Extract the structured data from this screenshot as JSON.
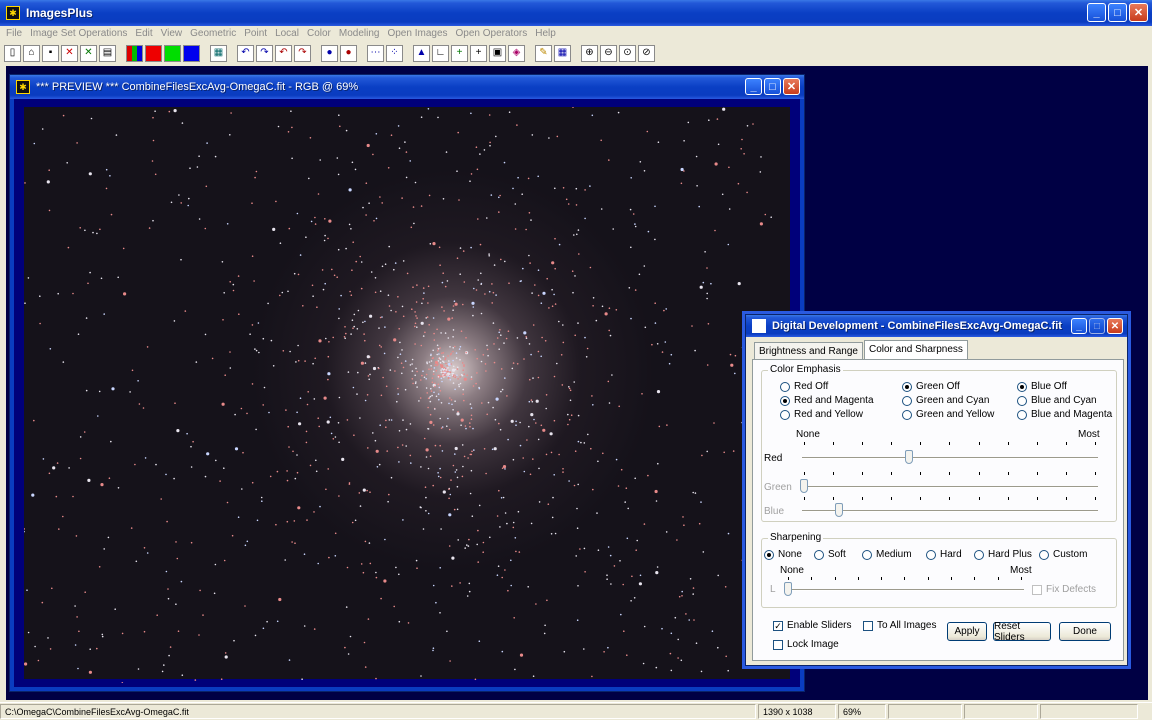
{
  "app": {
    "title": "ImagesPlus",
    "menu": [
      "File",
      "Image Set Operations",
      "Edit",
      "View",
      "Geometric",
      "Point",
      "Local",
      "Color",
      "Modeling",
      "Open Images",
      "Open Operators",
      "Help"
    ],
    "window_buttons": {
      "minimize": "_",
      "maximize": "□",
      "close": "✕"
    }
  },
  "toolbar": {
    "icons": [
      "new-icon",
      "open-icon",
      "save-icon",
      "close-red-icon",
      "close-green-icon",
      "print-icon",
      "rgb-channels-icon",
      "red-channel-icon",
      "green-channel-icon",
      "blue-channel-icon",
      "grid-icon",
      "undo-icon",
      "redo-icon",
      "undo-all-icon",
      "redo-all-icon",
      "circle-select-icon",
      "circle-red-icon",
      "dots-icon",
      "scatter-icon",
      "histogram-icon",
      "crop-icon",
      "crosshair-icon",
      "cross-icon",
      "calc-icon",
      "palette-icon",
      "pencil-icon",
      "table-icon",
      "zoom-in-icon",
      "zoom-out-icon",
      "zoom-fit-icon",
      "zoom-actual-icon"
    ]
  },
  "preview": {
    "title": "*** PREVIEW *** CombineFilesExcAvg-OmegaC.fit - RGB @ 69%"
  },
  "dialog": {
    "title": "Digital Development - CombineFilesExcAvg-OmegaC.fit",
    "tabs": [
      {
        "label": "Brightness and Range",
        "active": false
      },
      {
        "label": "Color and Sharpness",
        "active": true
      }
    ],
    "color_emphasis": {
      "label": "Color Emphasis",
      "red_options": [
        {
          "label": "Red Off",
          "selected": false
        },
        {
          "label": "Red and Magenta",
          "selected": true
        },
        {
          "label": "Red and Yellow",
          "selected": false
        }
      ],
      "green_options": [
        {
          "label": "Green Off",
          "selected": true
        },
        {
          "label": "Green and Cyan",
          "selected": false
        },
        {
          "label": "Green and Yellow",
          "selected": false
        }
      ],
      "blue_options": [
        {
          "label": "Blue Off",
          "selected": true
        },
        {
          "label": "Blue and Cyan",
          "selected": false
        },
        {
          "label": "Blue and Magenta",
          "selected": false
        }
      ],
      "scale_min": "None",
      "scale_max": "Most",
      "sliders": [
        {
          "label": "Red",
          "value": 0.36,
          "enabled": true
        },
        {
          "label": "Green",
          "value": 0.0,
          "enabled": false
        },
        {
          "label": "Blue",
          "value": 0.12,
          "enabled": false
        }
      ]
    },
    "sharpening": {
      "label": "Sharpening",
      "options": [
        {
          "label": "None",
          "selected": true
        },
        {
          "label": "Soft",
          "selected": false
        },
        {
          "label": "Medium",
          "selected": false
        },
        {
          "label": "Hard",
          "selected": false
        },
        {
          "label": "Hard Plus",
          "selected": false
        },
        {
          "label": "Custom",
          "selected": false
        }
      ],
      "scale_min": "None",
      "scale_max": "Most",
      "slider_label": "L",
      "slider_value": 0.0,
      "fix_defects": "Fix Defects"
    },
    "enable_sliders": {
      "label": "Enable Sliders",
      "checked": true
    },
    "to_all_images": {
      "label": "To All Images",
      "checked": false
    },
    "lock_image": {
      "label": "Lock Image",
      "checked": false
    },
    "buttons": {
      "apply": "Apply",
      "reset": "Reset Sliders",
      "done": "Done"
    }
  },
  "statusbar": {
    "path": "C:\\OmegaC\\CombineFilesExcAvg-OmegaC.fit",
    "dimensions": "1390 x 1038",
    "zoom": "69%"
  }
}
